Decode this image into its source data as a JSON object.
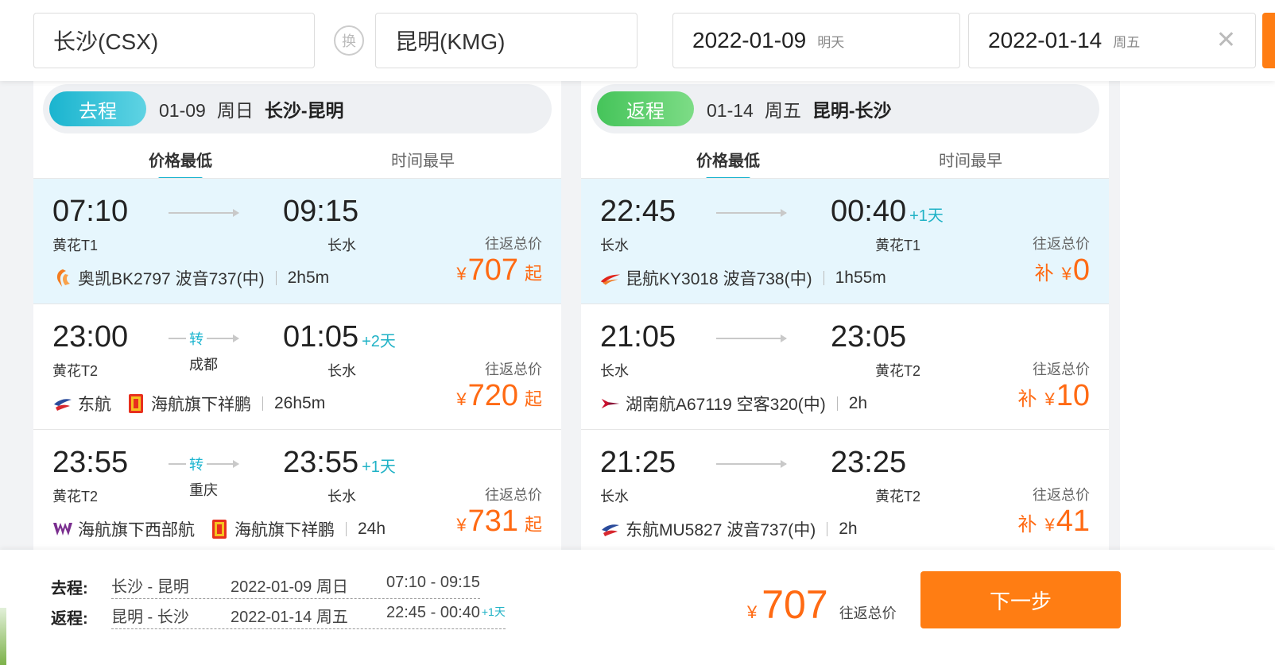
{
  "search": {
    "from": "长沙(CSX)",
    "swap_label": "换",
    "to": "昆明(KMG)",
    "depart_date": "2022-01-09",
    "depart_weekday": "明天",
    "return_date": "2022-01-14",
    "return_weekday": "周五"
  },
  "outbound": {
    "pill": "去程",
    "date": "01-09",
    "weekday": "周日",
    "route": "长沙-昆明",
    "sort_tabs": [
      "价格最低",
      "时间最早"
    ],
    "flights": [
      {
        "dep": "07:10",
        "arr": "09:15",
        "plus": "",
        "dep_ap": "黄花T1",
        "arr_ap": "长水",
        "transfer": "",
        "transfer_city": "",
        "airline": "奥凯BK2797 波音737(中)",
        "airline2": "",
        "duration": "2h5m",
        "price_label": "往返总价",
        "currency": "¥",
        "price": "707",
        "suffix": "起",
        "selected": true
      },
      {
        "dep": "23:00",
        "arr": "01:05",
        "plus": "+2天",
        "dep_ap": "黄花T2",
        "arr_ap": "长水",
        "transfer": "转",
        "transfer_city": "成都",
        "airline": "东航",
        "airline2": "海航旗下祥鹏",
        "duration": "26h5m",
        "price_label": "往返总价",
        "currency": "¥",
        "price": "720",
        "suffix": "起",
        "selected": false
      },
      {
        "dep": "23:55",
        "arr": "23:55",
        "plus": "+1天",
        "dep_ap": "黄花T2",
        "arr_ap": "长水",
        "transfer": "转",
        "transfer_city": "重庆",
        "airline": "海航旗下西部航",
        "airline2": "海航旗下祥鹏",
        "duration": "24h",
        "price_label": "往返总价",
        "currency": "¥",
        "price": "731",
        "suffix": "起",
        "selected": false
      }
    ]
  },
  "inbound": {
    "pill": "返程",
    "date": "01-14",
    "weekday": "周五",
    "route": "昆明-长沙",
    "sort_tabs": [
      "价格最低",
      "时间最早"
    ],
    "flights": [
      {
        "dep": "22:45",
        "arr": "00:40",
        "plus": "+1天",
        "dep_ap": "长水",
        "arr_ap": "黄花T1",
        "airline": "昆航KY3018 波音738(中)",
        "duration": "1h55m",
        "price_label": "往返总价",
        "bu": "补",
        "currency": "¥",
        "price": "0",
        "selected": true
      },
      {
        "dep": "21:05",
        "arr": "23:05",
        "plus": "",
        "dep_ap": "长水",
        "arr_ap": "黄花T2",
        "airline": "湖南航A67119 空客320(中)",
        "duration": "2h",
        "price_label": "往返总价",
        "bu": "补",
        "currency": "¥",
        "price": "10",
        "selected": false
      },
      {
        "dep": "21:25",
        "arr": "23:25",
        "plus": "",
        "dep_ap": "长水",
        "arr_ap": "黄花T2",
        "airline": "东航MU5827 波音737(中)",
        "duration": "2h",
        "price_label": "往返总价",
        "bu": "补",
        "currency": "¥",
        "price": "41",
        "selected": false
      }
    ]
  },
  "summary": {
    "out_label": "去程:",
    "out_route": "长沙 - 昆明",
    "out_date": "2022-01-09 周日",
    "out_time": "07:10 - 09:15",
    "ret_label": "返程:",
    "ret_route": "昆明 - 长沙",
    "ret_date": "2022-01-14 周五",
    "ret_time": "22:45 - 00:40",
    "ret_plus": "+1天",
    "currency": "¥",
    "total": "707",
    "total_label": "往返总价",
    "next_label": "下一步"
  },
  "colors": {
    "accent_teal": "#1ab4cf",
    "accent_green": "#45c45a",
    "price_orange": "#ff6a13",
    "button_orange": "#ff7d13",
    "selected_bg": "#e6f6fd"
  }
}
